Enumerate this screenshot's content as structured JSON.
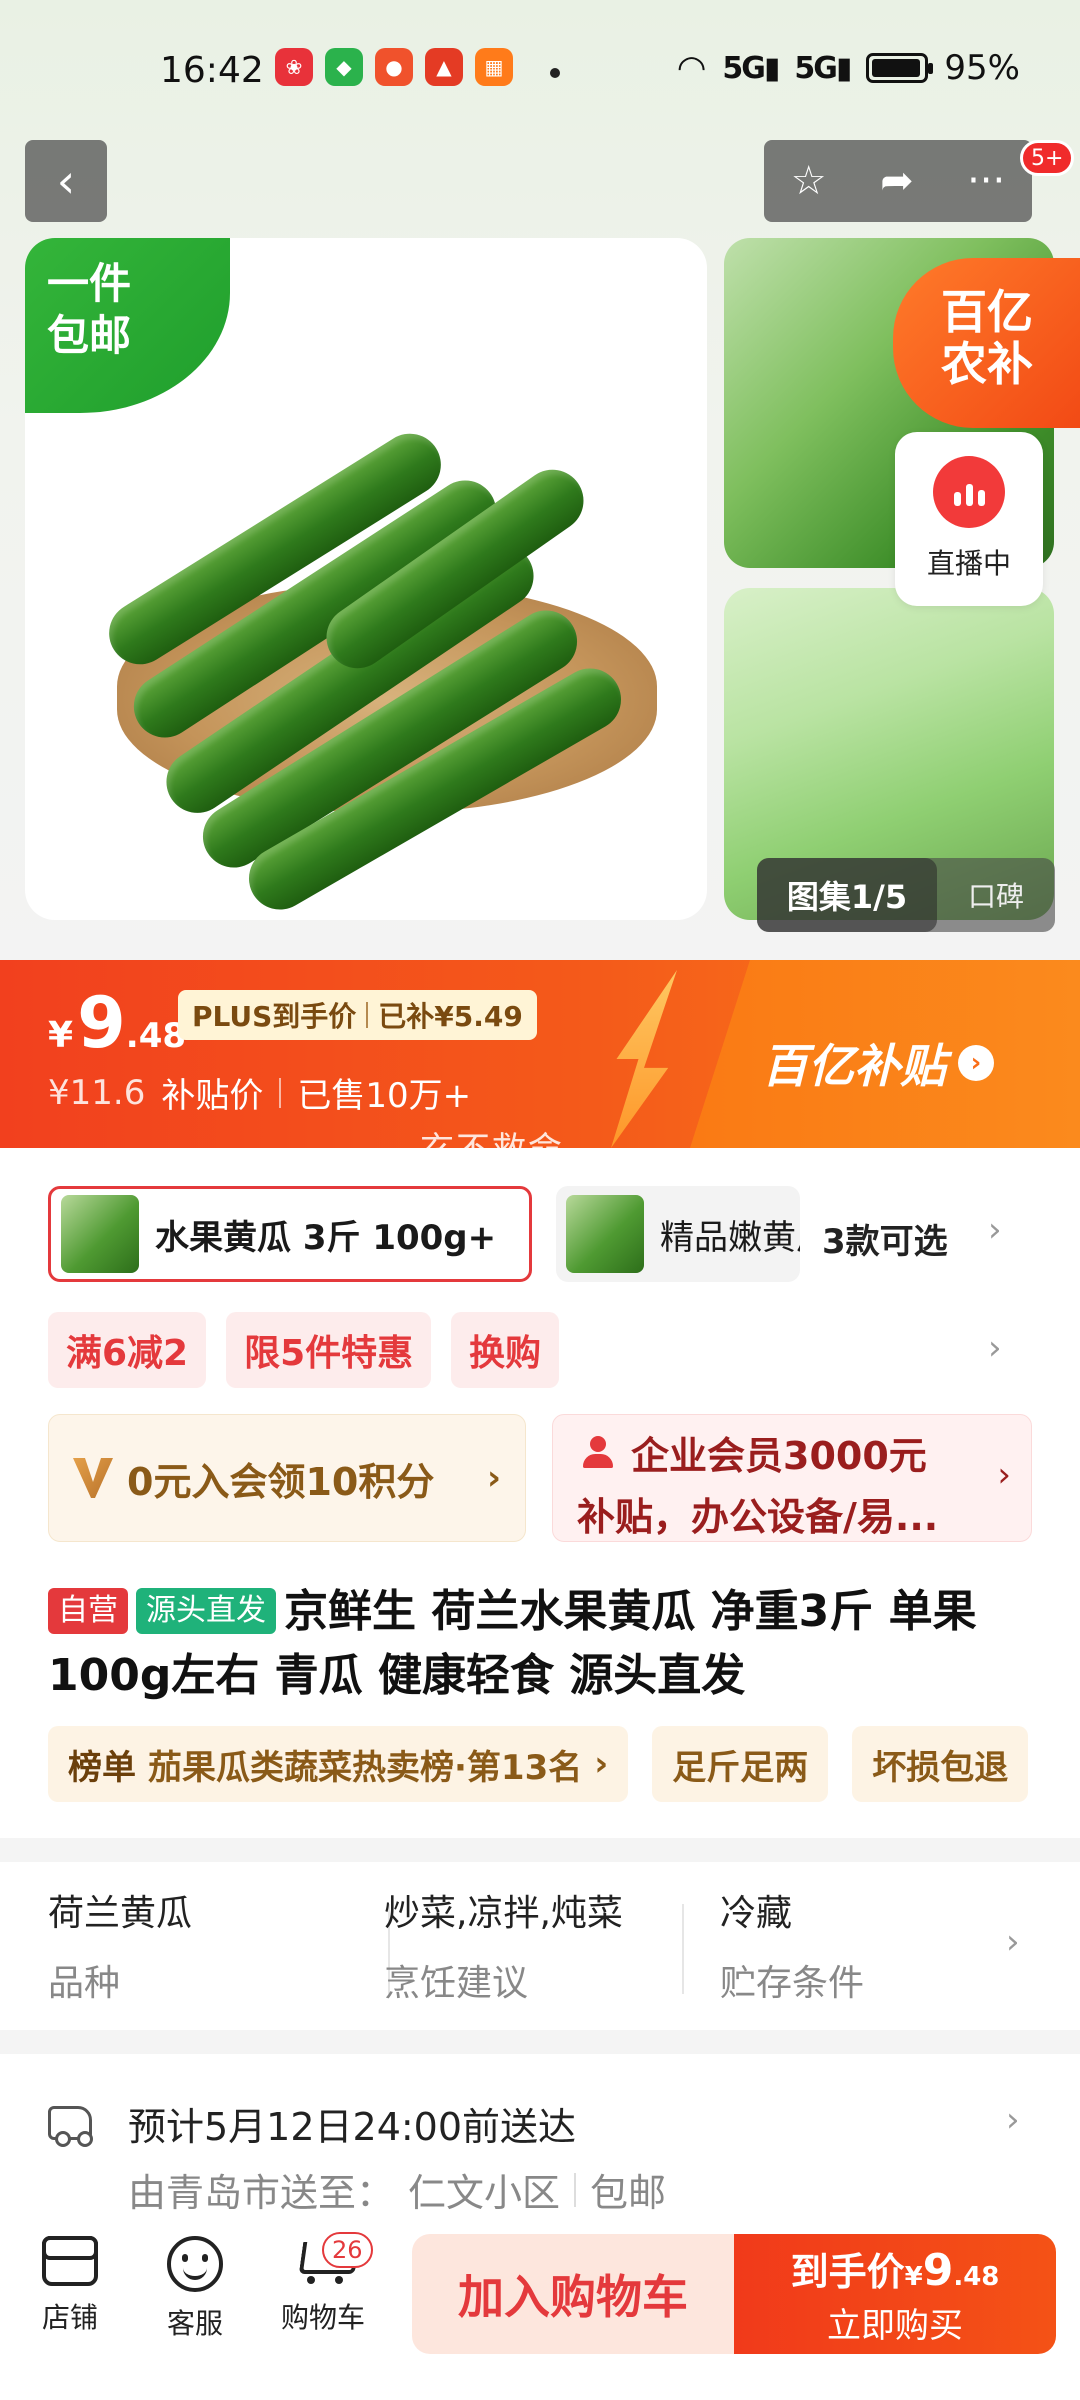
{
  "status_bar": {
    "time": "16:42",
    "net1": "5G",
    "net2": "5G",
    "battery": "95%",
    "battery_level": 0.95,
    "app_icons": [
      "app-icon-red",
      "app-icon-green",
      "app-icon-orange",
      "app-icon-red-hat",
      "app-icon-orange-grid"
    ]
  },
  "nav": {
    "back_icon": "‹",
    "star_icon": "☆",
    "share_icon": "➦",
    "more_icon": "···",
    "message_badge": "5+"
  },
  "gallery": {
    "freeship_line1": "一件",
    "freeship_line2": "包邮",
    "subsidy_line1": "百亿",
    "subsidy_line2": "农补",
    "live_label": "直播中",
    "counter": "图集1/5",
    "reviews_label": "口碑"
  },
  "price_banner": {
    "currency": "¥",
    "price_int": "9",
    "price_dec": ".48",
    "plus_label": "PLUS到手价",
    "subsidized": "已补¥5.49",
    "original_price": "¥11.6",
    "subsidy_price_label": "补贴价",
    "sold": "已售10万+",
    "slogan": "百亿补贴",
    "watermark": "玄不救命"
  },
  "sku": {
    "selected_label": "水果黄瓜 3斤 100g+",
    "other_label": "精品嫩黄瓜",
    "count_label": "3款可选"
  },
  "promotions": [
    "满6减2",
    "限5件特惠",
    "换购"
  ],
  "member": {
    "join_label": "0元入会领10积分",
    "biz_line1": "企业会员3000元",
    "biz_line2": "补贴，办公设备/易..."
  },
  "product": {
    "tag_self": "自营",
    "tag_source": "源头直发",
    "title": "京鲜生 荷兰水果黄瓜 净重3斤 单果100g左右 青瓜 健康轻食 源头直发"
  },
  "badges": {
    "rank_label": "榜单",
    "rank_text": "茄果瓜类蔬菜热卖榜·第13名",
    "badge2": "足斤足两",
    "badge3": "坏损包退"
  },
  "attributes": [
    {
      "value": "荷兰黄瓜",
      "key": "品种"
    },
    {
      "value": "炒菜,凉拌,炖菜",
      "key": "烹饪建议"
    },
    {
      "value": "冷藏",
      "key": "贮存条件"
    }
  ],
  "delivery": {
    "eta": "预计5月12日24:00前送达",
    "from_to": "由青岛市送至：",
    "address": "仁文小区",
    "shipping": "包邮"
  },
  "bottom_bar": {
    "shop": "店铺",
    "service": "客服",
    "cart": "购物车",
    "cart_count": "26",
    "add_to_cart": "加入购物车",
    "buy_price_label": "到手价",
    "buy_currency": "¥",
    "buy_price_int": "9",
    "buy_price_dec": ".48",
    "buy_now": "立即购买"
  },
  "colors": {
    "brand_red": "#e4393c",
    "banner_orange": "#f45a1a",
    "freeship_green": "#2fae37"
  }
}
